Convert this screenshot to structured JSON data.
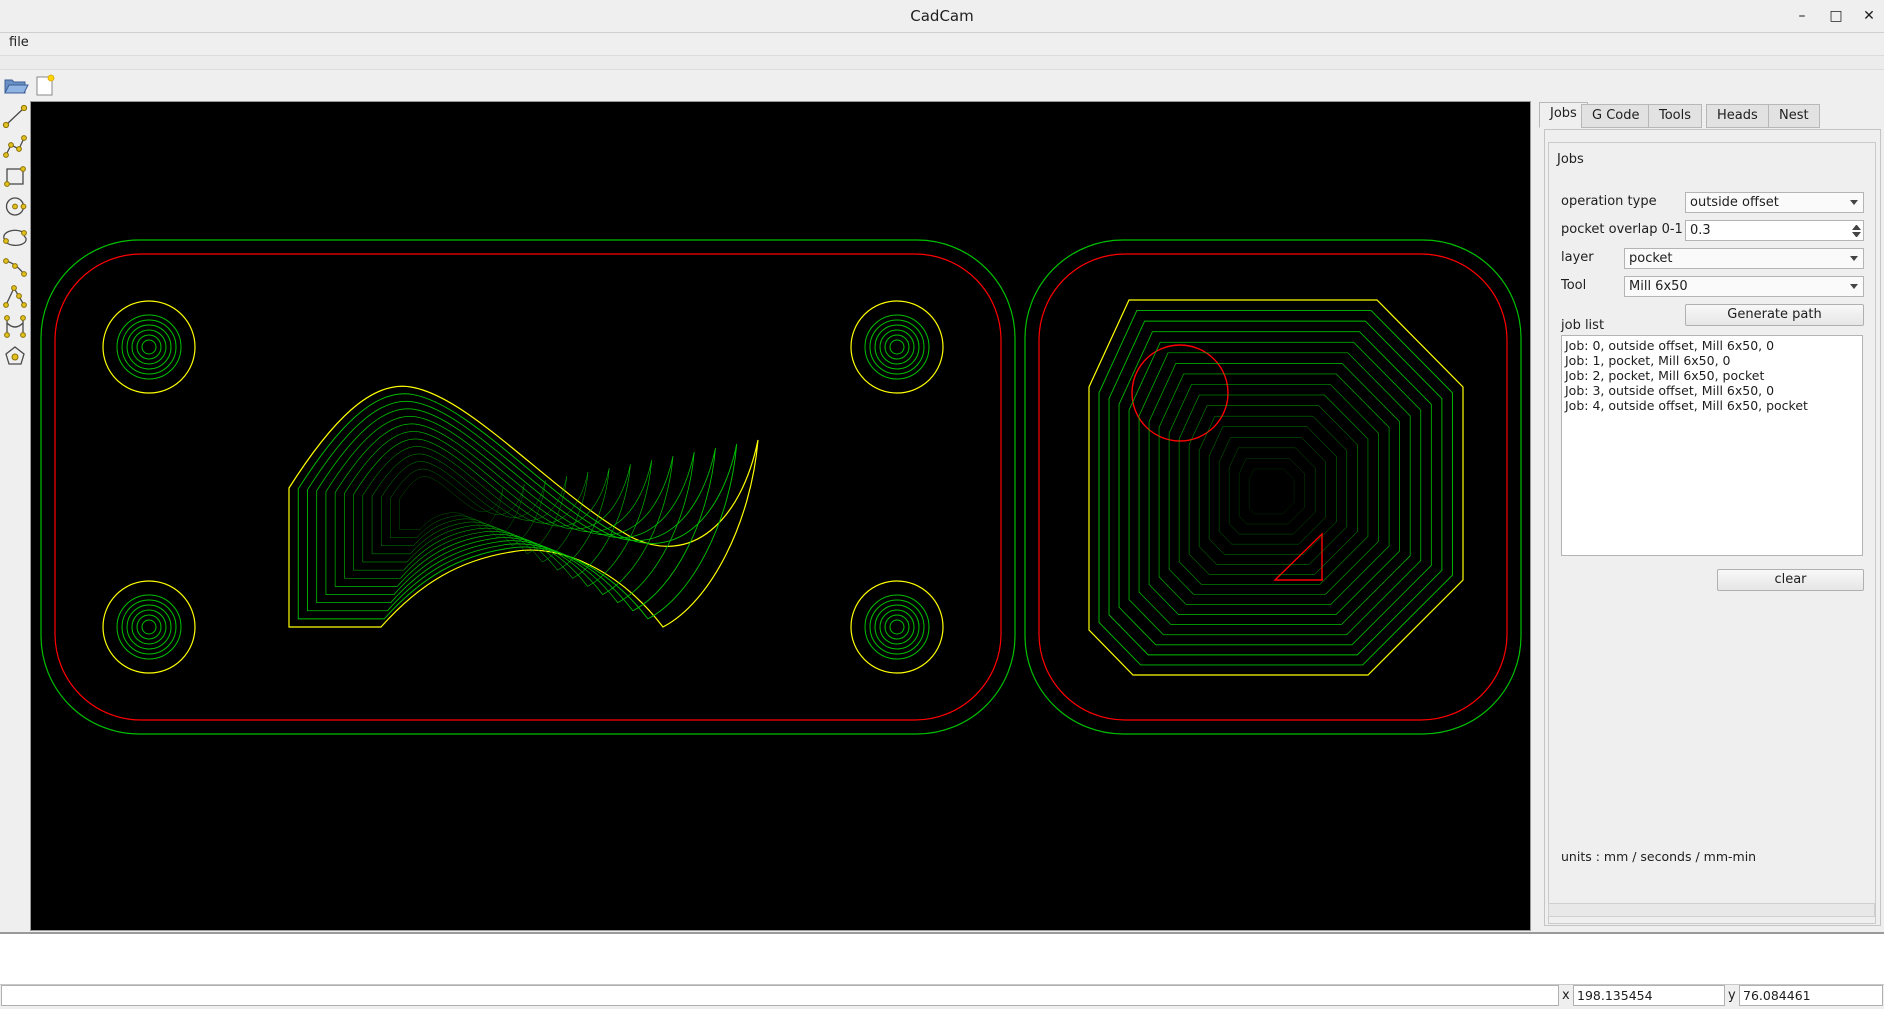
{
  "window": {
    "title": "CadCam",
    "minimize": "–",
    "maximize": "□",
    "close": "✕"
  },
  "menubar": {
    "file": "file"
  },
  "tabs": [
    {
      "label": "Jobs",
      "active": true
    },
    {
      "label": "G Code"
    },
    {
      "label": "Tools"
    },
    {
      "label": "Heads"
    },
    {
      "label": "Nest"
    }
  ],
  "jobs": {
    "group_title": "Jobs",
    "operation_type": {
      "label": "operation type",
      "value": "outside offset"
    },
    "pocket_overlap": {
      "label": "pocket overlap 0-1",
      "value": "0.3"
    },
    "layer": {
      "label": "layer",
      "value": "pocket"
    },
    "tool": {
      "label": "Tool",
      "value": "Mill 6x50"
    },
    "generate_label": "Generate path",
    "job_list_label": "job list",
    "job_list": [
      "Job: 0, outside offset, Mill 6x50, 0",
      "Job: 1, pocket, Mill 6x50, 0",
      "Job: 2, pocket, Mill 6x50, pocket",
      "Job: 3, outside offset, Mill 6x50, 0",
      "Job: 4, outside offset, Mill 6x50, pocket"
    ],
    "clear_label": "clear",
    "units": "units : mm / seconds / mm-min"
  },
  "status": {
    "x_label": "x",
    "x_value": "198.135454",
    "y_label": "y",
    "y_value": "76.084461"
  },
  "colors": {
    "canvas_bg": "#000000",
    "offset_path": "#00c000",
    "part_outline": "#ff0000",
    "pocket_outline": "#ffff00",
    "pocket_fill": "#00c000"
  },
  "icons": {
    "toolbar": [
      "open-folder-icon",
      "new-file-icon"
    ],
    "draw_tools": [
      "line-tool-icon",
      "polyline-tool-icon",
      "rectangle-tool-icon",
      "circle-tool-icon",
      "arc-tool-icon",
      "spline-tool-icon",
      "bezier-tool-icon",
      "curve-tool-icon",
      "polygon-tool-icon"
    ]
  }
}
